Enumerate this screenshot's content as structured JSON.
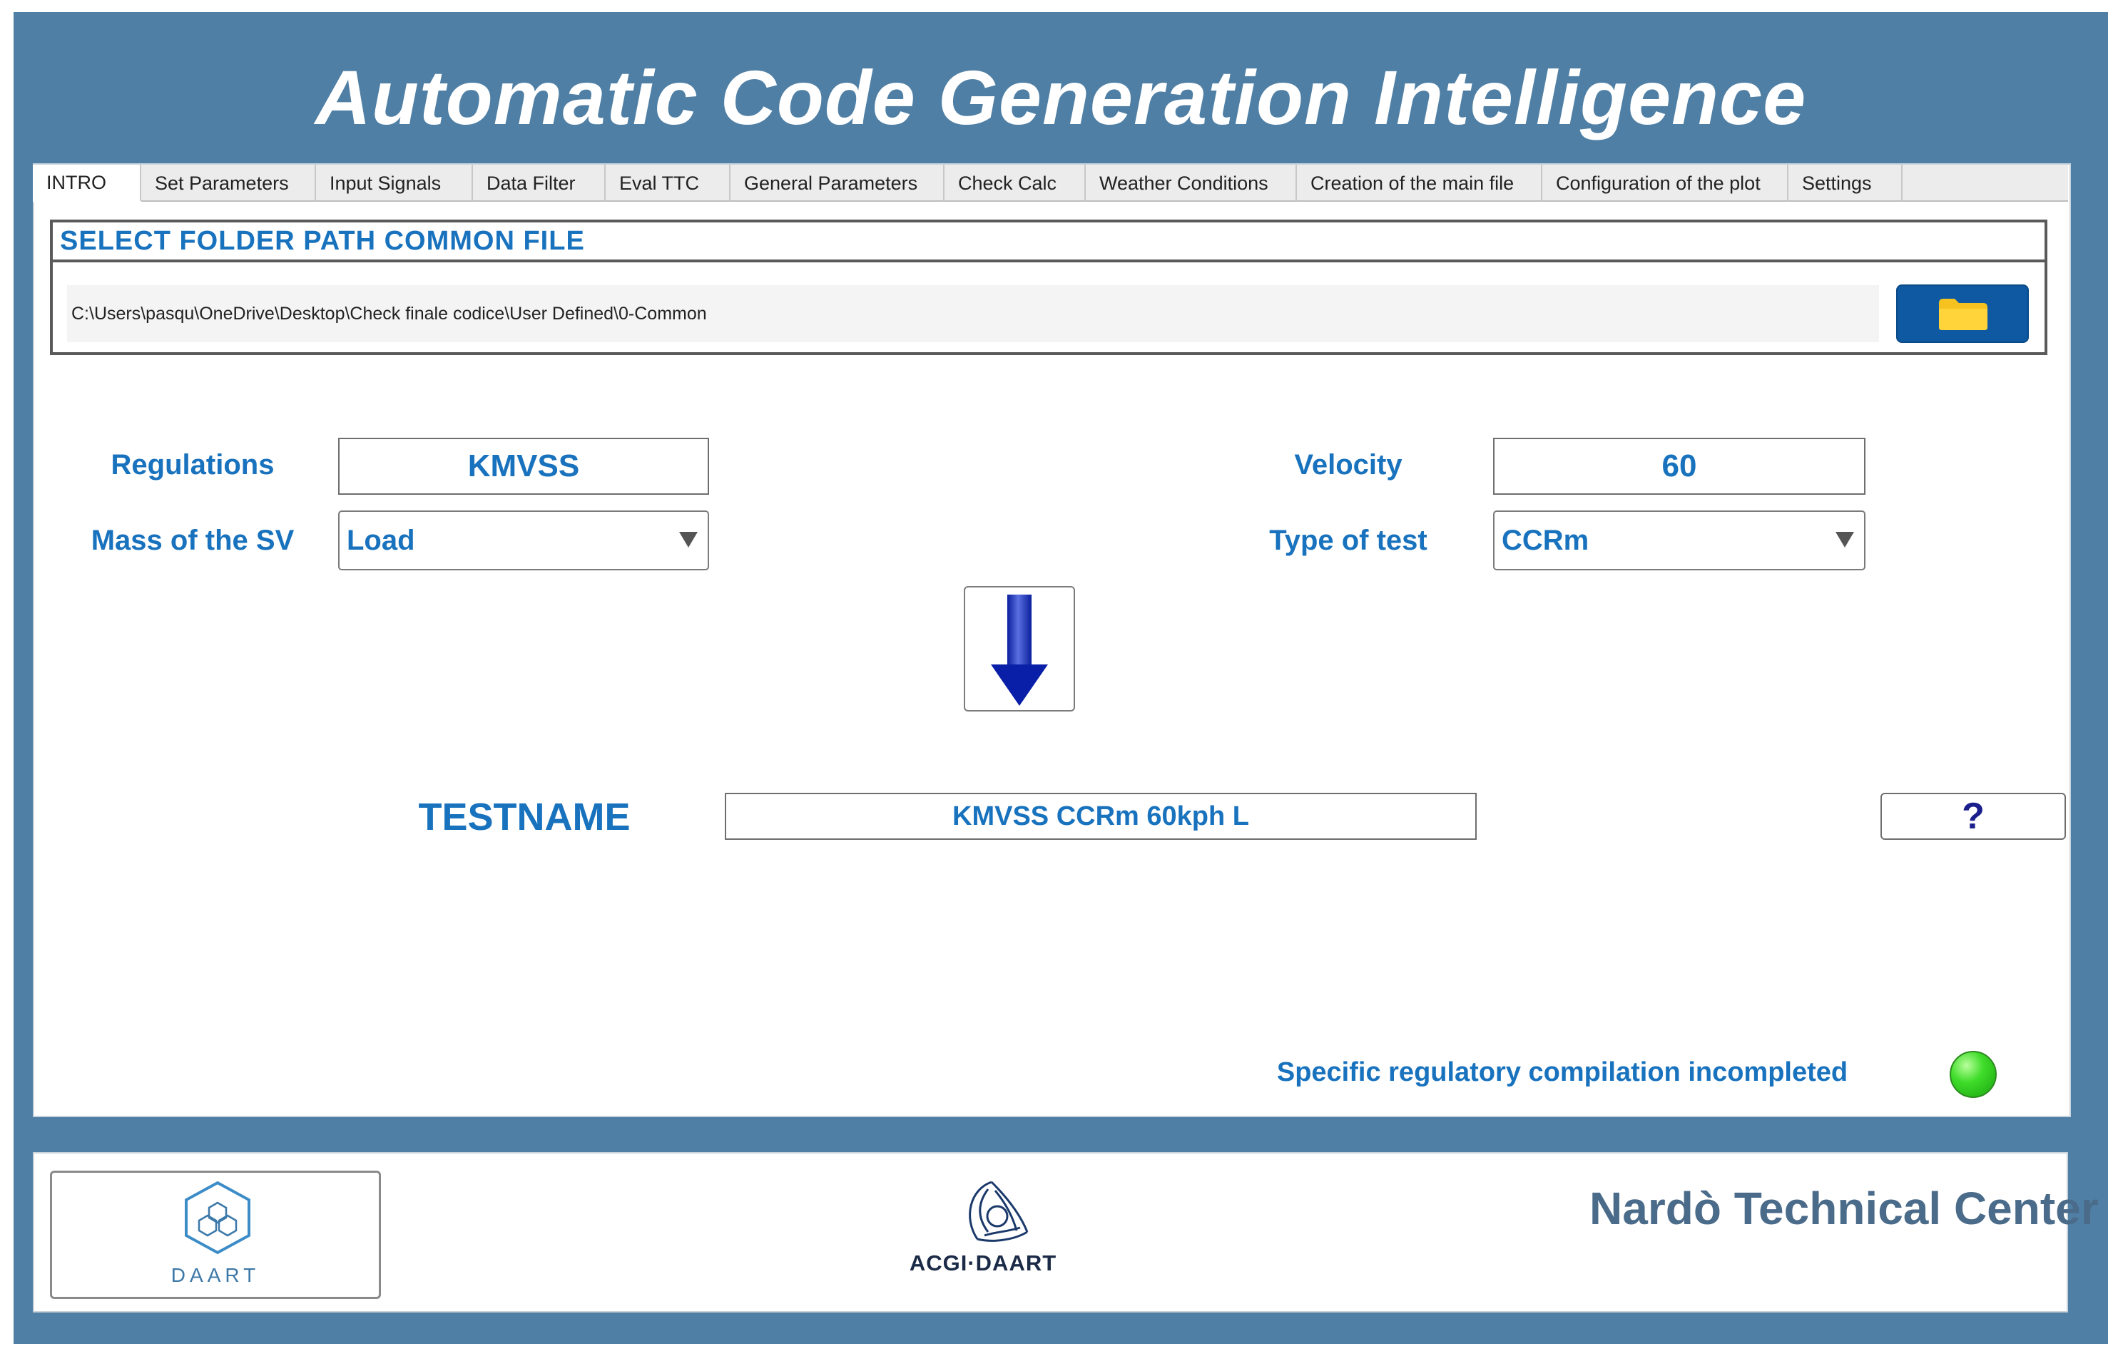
{
  "header": {
    "title": "Automatic Code Generation Intelligence"
  },
  "tabs": [
    {
      "label": "INTRO",
      "active": true
    },
    {
      "label": "Set Parameters",
      "active": false
    },
    {
      "label": "Input Signals",
      "active": false
    },
    {
      "label": "Data Filter",
      "active": false
    },
    {
      "label": "Eval TTC",
      "active": false
    },
    {
      "label": "General Parameters",
      "active": false
    },
    {
      "label": "Check Calc",
      "active": false
    },
    {
      "label": "Weather Conditions",
      "active": false
    },
    {
      "label": "Creation of the main file",
      "active": false
    },
    {
      "label": "Configuration of the plot",
      "active": false
    },
    {
      "label": "Settings",
      "active": false
    }
  ],
  "folder": {
    "header": "SELECT  FOLDER PATH COMMON FILE",
    "path": "C:\\Users\\pasqu\\OneDrive\\Desktop\\Check finale codice\\User Defined\\0-Common",
    "button_icon": "folder-icon"
  },
  "form": {
    "regulations_label": "Regulations",
    "regulations_value": "KMVSS",
    "mass_label": "Mass of the SV",
    "mass_value": "Load",
    "velocity_label": "Velocity",
    "velocity_value": "60",
    "type_label": "Type of test",
    "type_value": "CCRm"
  },
  "action": {
    "icon": "arrow-down-icon"
  },
  "testname": {
    "label": "TESTNAME",
    "value": "KMVSS CCRm 60kph L",
    "help_label": "?"
  },
  "status": {
    "text": "Specific regulatory compilation incompleted",
    "light_color": "#3fdc2a"
  },
  "footer": {
    "daart_label": "DAART",
    "acgi_label": "ACGI·DAART",
    "ntc_label": "Nardò Technical Center"
  },
  "colors": {
    "frame": "#4f7fa4",
    "accent": "#1872bd",
    "button": "#0e59a1"
  }
}
